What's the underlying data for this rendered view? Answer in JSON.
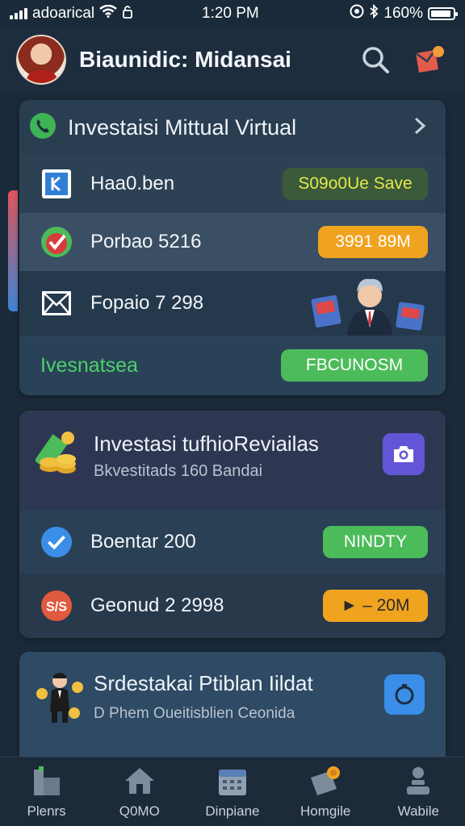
{
  "status_bar": {
    "carrier": "adoarical",
    "time": "1:20 PM",
    "battery": "160%"
  },
  "header": {
    "user_name": "Biaunidic: Midansai",
    "icons": [
      "search-icon",
      "notification-icon"
    ]
  },
  "card1": {
    "title": "Investaisi Mittual Virtual",
    "rows": [
      {
        "label": "Haa0.ben",
        "badge": "S09o0Ue Save",
        "icon": "contact-card-icon"
      },
      {
        "label": "Porbao 5216",
        "badge": "3991 89M",
        "icon": "check-badge-icon"
      },
      {
        "label": "Fopaio 7 298",
        "icon": "mail-icon"
      }
    ],
    "footer_label": "Ivesnatsea",
    "footer_button": "FBCUNOSM"
  },
  "card2": {
    "title": "Investasi tufhioReviailas",
    "subtitle": "Bkvestitads 160 Bandai",
    "rows": [
      {
        "label": "Boentar 200",
        "badge": "NINDTY",
        "icon": "checkmark-icon"
      },
      {
        "label": "Geonud 2 2998",
        "badge": "► ‒ 20M",
        "icon": "percent-icon"
      }
    ]
  },
  "card3": {
    "title": "Srdestakai Ptiblan Iildat",
    "subtitle": "Phem Oueitisblien Ceonida",
    "subtitle_prefix": "D"
  },
  "nav": {
    "items": [
      {
        "label": "Plenrs",
        "icon": "building-icon"
      },
      {
        "label": "Q0MO",
        "icon": "home-icon"
      },
      {
        "label": "Dinpiane",
        "icon": "calendar-icon"
      },
      {
        "label": "Homgile",
        "icon": "wallet-icon"
      },
      {
        "label": "Wabile",
        "icon": "profile-icon"
      }
    ]
  },
  "colors": {
    "background": "#1b2a3a",
    "card": "#2a3e52",
    "green": "#4cbb5a",
    "orange": "#f0a31f",
    "purple": "#6356d6",
    "blue": "#3a8ee8"
  }
}
